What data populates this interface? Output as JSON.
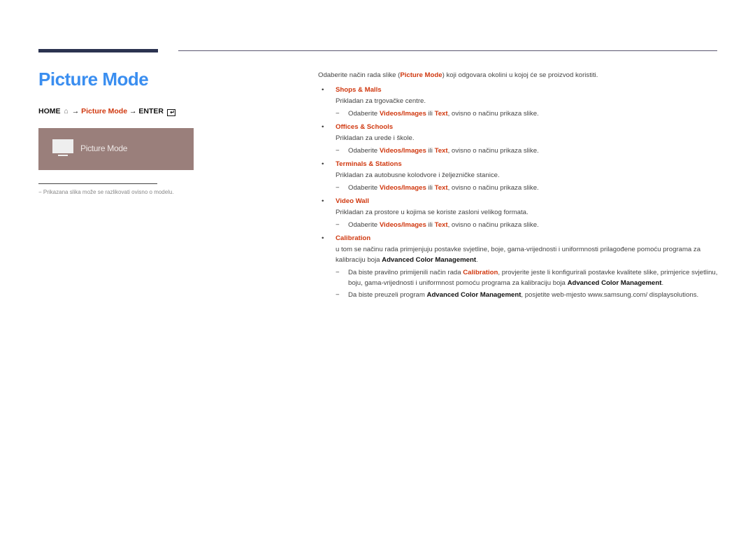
{
  "header": {
    "title": "Picture Mode"
  },
  "path": {
    "home": "HOME",
    "home_icon": "⌂",
    "arrow1": "→",
    "picture_mode": "Picture Mode",
    "arrow2": "→",
    "enter": "ENTER",
    "enter_icon": "↵"
  },
  "preview": {
    "label": "Picture Mode"
  },
  "note": {
    "dash": "−",
    "text": "Prikazana slika može se razlikovati ovisno o modelu."
  },
  "intro": {
    "before": "Odaberite način rada slike (",
    "highlight": "Picture Mode",
    "after": ") koji odgovara okolini u kojoj će se proizvod koristiti."
  },
  "sub_common": {
    "before": "Odaberite ",
    "opt1": "Videos/Images",
    "mid": " ili ",
    "opt2": "Text",
    "after": ", ovisno o načinu prikaza slike."
  },
  "modes": [
    {
      "title": "Shops & Malls",
      "desc": "Prikladan za trgovačke centre."
    },
    {
      "title": "Offices & Schools",
      "desc": "Prikladan za urede i škole."
    },
    {
      "title": "Terminals & Stations",
      "desc": "Prikladan za autobusne kolodvore i željezničke stanice."
    },
    {
      "title": "Video Wall",
      "desc": "Prikladan za prostore u kojima se koriste zasloni velikog formata."
    }
  ],
  "calibration": {
    "title": "Calibration",
    "desc_before": "u tom se načinu rada primjenjuju postavke svjetline, boje, gama-vrijednosti i uniformnosti prilagođene pomoću programa za kalibraciju boja ",
    "desc_bold": "Advanced Color Management",
    "desc_after": ".",
    "sub1_before": "Da biste pravilno primijenili način rada ",
    "sub1_red": "Calibration",
    "sub1_mid": ", provjerite jeste li konfigurirali postavke kvalitete slike, primjerice svjetlinu, boju, gama-vrijednosti i uniformnost pomoću programa za kalibraciju boja ",
    "sub1_bold": "Advanced Color Management",
    "sub1_after": ".",
    "sub2_before": "Da biste preuzeli program ",
    "sub2_bold": "Advanced Color Management",
    "sub2_after": ", posjetite web-mjesto www.samsung.com/ displaysolutions."
  },
  "symbols": {
    "bullet": "•",
    "dash": "−"
  }
}
